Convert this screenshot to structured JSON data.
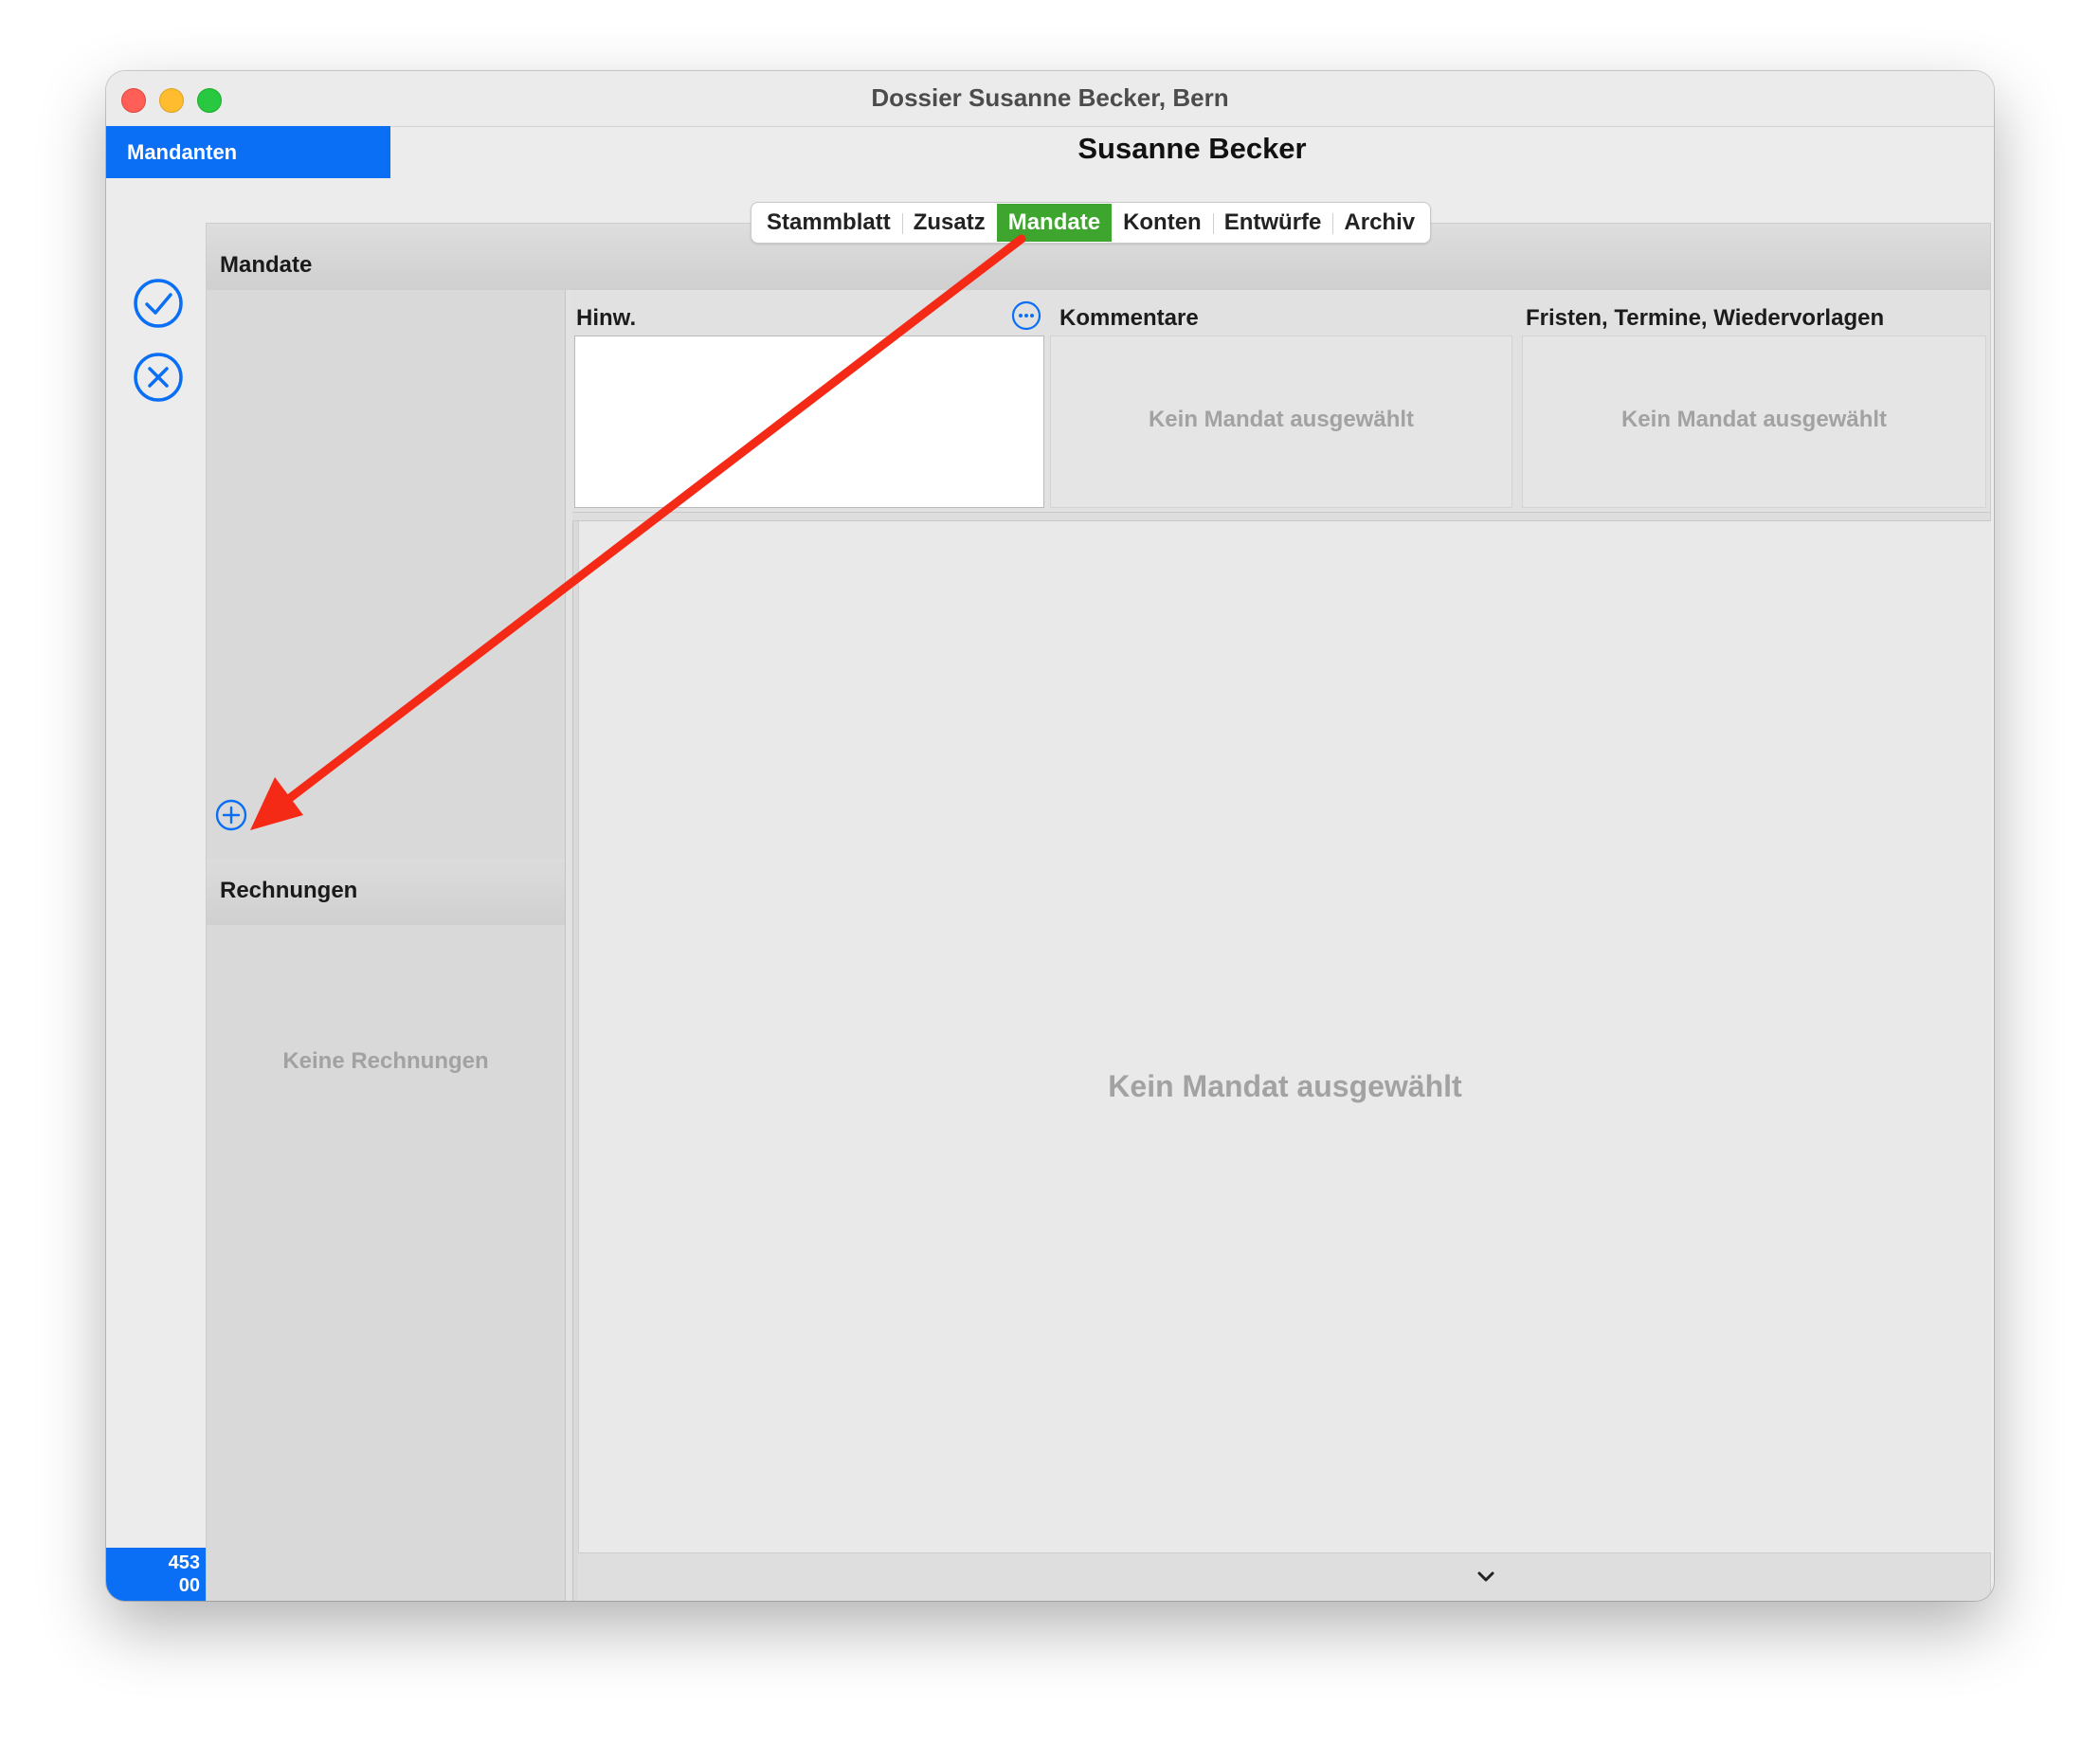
{
  "window": {
    "title": "Dossier Susanne Becker, Bern"
  },
  "header": {
    "mandanten_label": "Mandanten",
    "client_name": "Susanne Becker"
  },
  "tabs": [
    {
      "label": "Stammblatt",
      "active": false
    },
    {
      "label": "Zusatz",
      "active": false
    },
    {
      "label": "Mandate",
      "active": true
    },
    {
      "label": "Konten",
      "active": false
    },
    {
      "label": "Entwürfe",
      "active": false
    },
    {
      "label": "Archiv",
      "active": false
    }
  ],
  "sidebar": {
    "confirm_icon": "checkmark-circle-icon",
    "cancel_icon": "xmark-circle-icon",
    "counter_line1": "453",
    "counter_line2": "00"
  },
  "mandate": {
    "title": "Mandate",
    "add_icon": "plus-circle-icon"
  },
  "rechnungen": {
    "title": "Rechnungen",
    "empty": "Keine Rechnungen"
  },
  "columns": {
    "hinweis": {
      "title": "Hinw.",
      "more_icon": "ellipsis-circle-icon"
    },
    "kommentare": {
      "title": "Kommentare",
      "empty": "Kein Mandat ausgewählt"
    },
    "fristen": {
      "title": "Fristen, Termine, Wiedervorlagen",
      "empty": "Kein Mandat ausgewählt"
    }
  },
  "detail": {
    "empty": "Kein Mandat ausgewählt"
  },
  "colors": {
    "accent_blue": "#0a6ff5",
    "active_tab_green": "#3ea52e",
    "annotation_red": "#f52a16"
  }
}
